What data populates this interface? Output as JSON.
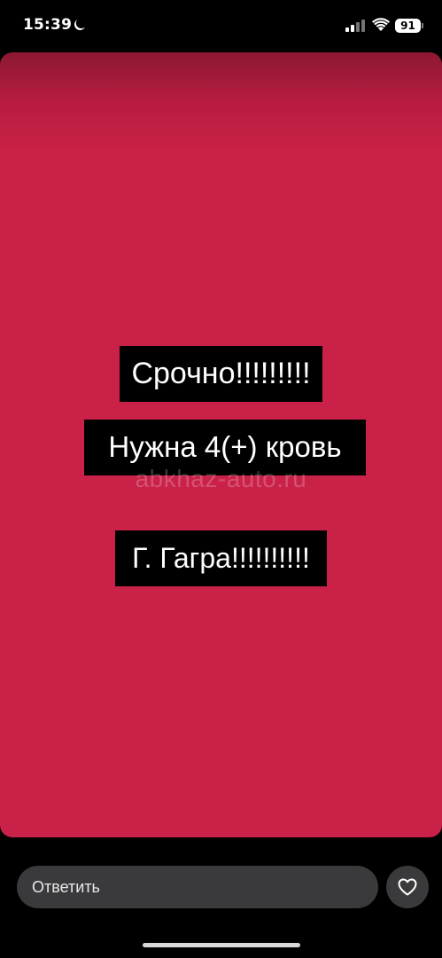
{
  "status_bar": {
    "time": "15:39",
    "battery_level": "91",
    "icons": [
      "moon-icon",
      "signal-icon",
      "wifi-icon",
      "battery-icon"
    ]
  },
  "story": {
    "background_color": "#c92147",
    "lines": [
      "Срочно!!!!!!!!!",
      "Нужна 4(+) кровь",
      "Г. Гагра!!!!!!!!!!"
    ],
    "watermark": "abkhaz-auto.ru"
  },
  "reply_bar": {
    "placeholder": "Ответить",
    "like_icon": "heart-icon"
  }
}
